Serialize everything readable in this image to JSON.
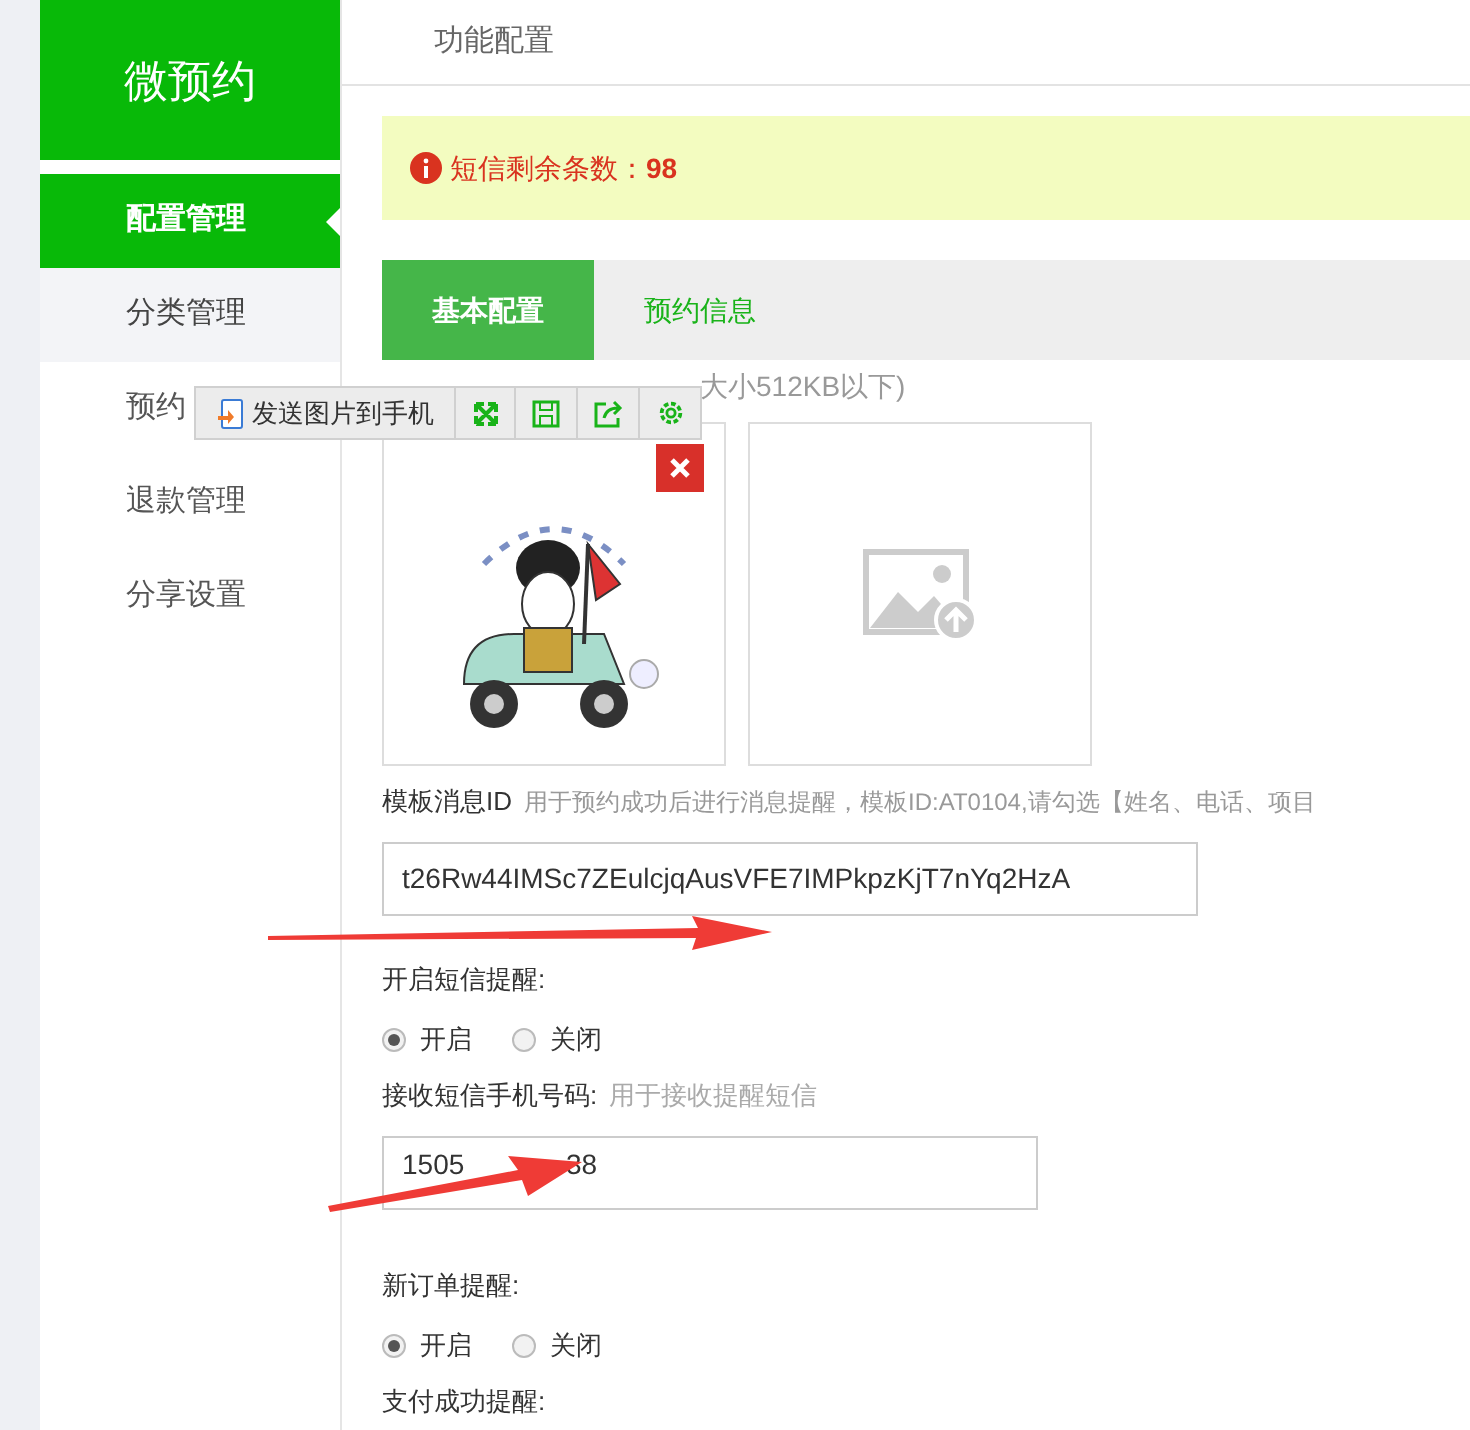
{
  "logo": "微预约",
  "sidebar": {
    "items": [
      {
        "label": "配置管理",
        "selected": true
      },
      {
        "label": "分类管理",
        "selected": false
      },
      {
        "label": "预约",
        "selected": false
      },
      {
        "label": "退款管理",
        "selected": false
      },
      {
        "label": "分享设置",
        "selected": false
      }
    ]
  },
  "header": {
    "title": "功能配置"
  },
  "notice": {
    "text": "短信剩余条数：**98**"
  },
  "tabs": [
    {
      "label": "基本配置",
      "selected": true
    },
    {
      "label": "预约信息",
      "selected": false
    }
  ],
  "image_upload": {
    "hint": "大小512KB以下)",
    "images": [
      {
        "kind": "picture"
      },
      {
        "kind": "placeholder"
      }
    ]
  },
  "image_toolbar": {
    "send_label": "发送图片到手机"
  },
  "template": {
    "label": "模板消息ID",
    "hint": "用于预约成功后进行消息提醒，模板ID:AT0104,请勾选【姓名、电话、项目",
    "value": "t26Rw44IMSc7ZEulcjqAusVFE7IMPkpzKjT7nYq2HzA"
  },
  "settings": [
    {
      "kind": "radio",
      "label": "开启短信提醒:",
      "options": [
        {
          "label": "开启",
          "selected": true
        },
        {
          "label": "关闭",
          "selected": false
        }
      ]
    },
    {
      "kind": "input",
      "label": "接收短信手机号码:",
      "hint": "用于接收提醒短信",
      "value": "1505",
      "value_end": "38"
    },
    {
      "kind": "radio",
      "label": "新订单提醒:",
      "options": [
        {
          "label": "开启",
          "selected": true
        },
        {
          "label": "关闭",
          "selected": false
        }
      ]
    },
    {
      "kind": "radio",
      "label": "支付成功提醒:"
    }
  ]
}
